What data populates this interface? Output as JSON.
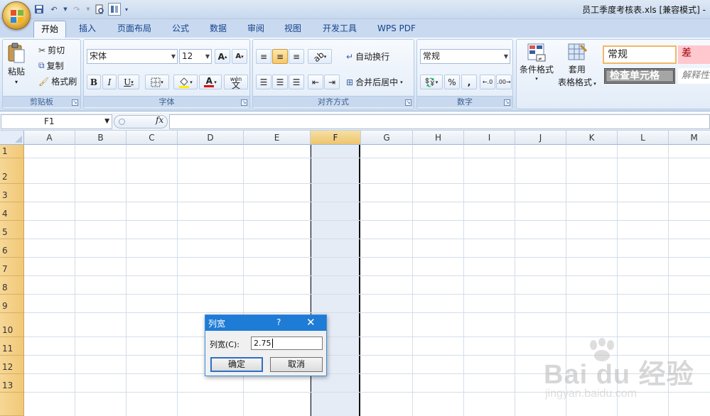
{
  "window": {
    "title": "员工季度考核表.xls [兼容模式] -"
  },
  "tabs": [
    "开始",
    "插入",
    "页面布局",
    "公式",
    "数据",
    "审阅",
    "视图",
    "开发工具",
    "WPS PDF"
  ],
  "clipboard": {
    "paste": "粘贴",
    "cut": "剪切",
    "copy": "复制",
    "format_painter": "格式刷",
    "label": "剪贴板"
  },
  "font": {
    "name": "宋体",
    "size": "12",
    "label": "字体",
    "bold": "B",
    "italic": "I",
    "underline": "U",
    "grow": "A",
    "shrink": "A",
    "font_color": "A",
    "phonetic": "wén"
  },
  "alignment": {
    "wrap": "自动换行",
    "merge": "合并后居中",
    "label": "对齐方式"
  },
  "number": {
    "format": "常规",
    "percent": "%",
    "comma": ",",
    "label": "数字"
  },
  "styles": {
    "conditional": "条件格式",
    "table_format_1": "套用",
    "table_format_2": "表格格式",
    "normal": "常规",
    "bad": "差",
    "check_cell": "检查单元格",
    "explanatory": "解释性"
  },
  "formula_bar": {
    "name_box": "F1",
    "fx": "fx",
    "value": ""
  },
  "grid": {
    "columns": [
      "A",
      "B",
      "C",
      "D",
      "E",
      "F",
      "G",
      "H",
      "I",
      "J",
      "K",
      "L",
      "M"
    ],
    "rows": [
      "1",
      "2",
      "3",
      "4",
      "5",
      "6",
      "7",
      "8",
      "9",
      "10",
      "11",
      "12",
      "13"
    ],
    "selected_column": "F"
  },
  "dialog": {
    "title": "列宽",
    "help": "?",
    "close": "✕",
    "field_label": "列宽(C):",
    "value": "2.75",
    "ok": "确定",
    "cancel": "取消"
  },
  "watermark": {
    "brand": "Bai du 经验",
    "url": "jingyan.baidu.com"
  }
}
